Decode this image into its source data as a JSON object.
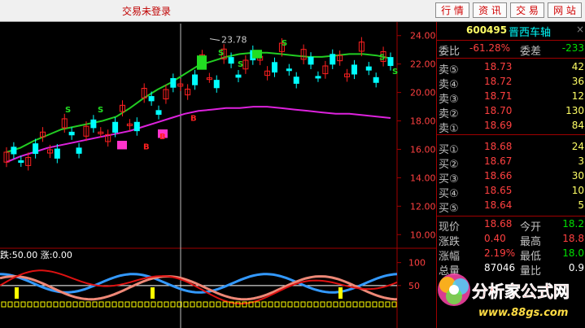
{
  "top": {
    "status": "交易未登录",
    "tabs": [
      "行 情",
      "资 讯",
      "交 易",
      "网 站"
    ]
  },
  "chart": {
    "y_ticks": [
      "24.00",
      "22.00",
      "20.00",
      "18.00",
      "16.00",
      "14.00",
      "12.00",
      "10.00"
    ],
    "y_values": [
      24,
      22,
      20,
      18,
      16,
      14,
      12,
      10
    ],
    "peak_label": "23.78",
    "osc_header": "跌:50.00  涨:0.00",
    "osc_ticks": [
      "100",
      "50"
    ],
    "osc_values": [
      100,
      50
    ],
    "signal_s": "S",
    "signal_b": "B",
    "colors": {
      "ma_fast": "#22cc22",
      "ma_slow": "#dd22dd",
      "up": "#00ffff",
      "accent": "#ff2020"
    }
  },
  "chart_data": {
    "type": "candlestick",
    "ylim": [
      9.5,
      24.5
    ],
    "y_ticks": [
      24,
      22,
      20,
      18,
      16,
      14,
      12,
      10
    ],
    "annotations": [
      {
        "text": "23.78",
        "value": 23.78
      }
    ],
    "series": [
      {
        "name": "",
        "values": [
          15.8,
          16.1,
          16.6,
          17.0,
          17.4,
          17.6,
          17.8,
          18.0,
          18.3,
          18.9,
          19.6,
          20.2,
          20.7,
          21.3,
          21.9,
          22.2,
          22.5,
          22.7,
          22.8,
          22.8,
          22.7,
          22.6,
          22.5,
          22.5,
          22.6,
          22.7,
          22.7,
          22.6,
          22.4
        ]
      },
      {
        "name": "",
        "values": [
          15.1,
          15.5,
          15.8,
          16.1,
          16.3,
          16.5,
          16.7,
          16.9,
          17.1,
          17.3,
          17.6,
          17.9,
          18.2,
          18.5,
          18.7,
          18.8,
          18.9,
          18.9,
          19.0,
          19.0,
          18.9,
          18.8,
          18.7,
          18.6,
          18.5,
          18.5,
          18.4,
          18.3,
          18.2
        ]
      }
    ],
    "oscillator": {
      "ticks": [
        100,
        50
      ],
      "labels": [
        "跌:50.00",
        "涨:0.00"
      ]
    }
  },
  "panel": {
    "code": "600495",
    "name": "晋西车轴",
    "close": "×",
    "ratio_label": "委比",
    "ratio_value": "-61.28%",
    "diff_label": "委差",
    "diff_value": "-233",
    "sells": [
      {
        "label": "卖⑤",
        "price": "18.73",
        "vol": "42"
      },
      {
        "label": "卖④",
        "price": "18.72",
        "vol": "36"
      },
      {
        "label": "卖③",
        "price": "18.71",
        "vol": "12"
      },
      {
        "label": "卖②",
        "price": "18.70",
        "vol": "130"
      },
      {
        "label": "卖①",
        "price": "18.69",
        "vol": "84"
      }
    ],
    "buys": [
      {
        "label": "买①",
        "price": "18.68",
        "vol": "24"
      },
      {
        "label": "买②",
        "price": "18.67",
        "vol": "3"
      },
      {
        "label": "买③",
        "price": "18.66",
        "vol": "30"
      },
      {
        "label": "买④",
        "price": "18.65",
        "vol": "10"
      },
      {
        "label": "买⑤",
        "price": "18.64",
        "vol": "5"
      }
    ],
    "stats": [
      {
        "l1": "现价",
        "v1": "18.68",
        "c1": "red",
        "l2": "今开",
        "v2": "18.2",
        "c2": "green"
      },
      {
        "l1": "涨跌",
        "v1": "0.40",
        "c1": "red",
        "l2": "最高",
        "v2": "18.8",
        "c2": "red"
      },
      {
        "l1": "涨幅",
        "v1": "2.19%",
        "c1": "red",
        "l2": "最低",
        "v2": "18.0",
        "c2": "green"
      },
      {
        "l1": "总量",
        "v1": "87046",
        "c1": "white",
        "l2": "量比",
        "v2": "0.9",
        "c2": "white"
      }
    ]
  },
  "watermark": {
    "title": "分析家公式网",
    "url": "www.88gs.com"
  }
}
